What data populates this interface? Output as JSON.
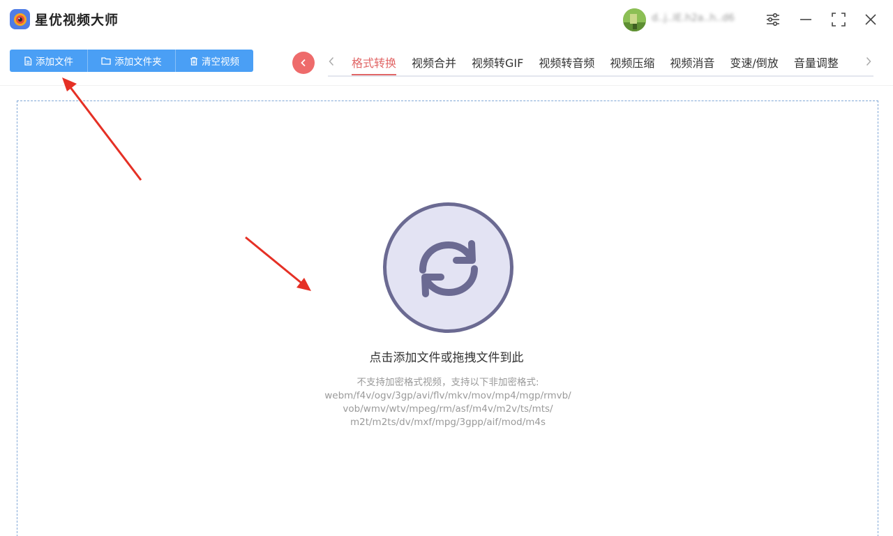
{
  "app": {
    "title": "星优视频大师",
    "username": "d..j..IE.h2a..h..d6"
  },
  "toolbar": {
    "add_file": "添加文件",
    "add_folder": "添加文件夹",
    "clear_videos": "清空视频"
  },
  "tabs": [
    {
      "label": "格式转换",
      "active": true
    },
    {
      "label": "视频合并"
    },
    {
      "label": "视频转GIF"
    },
    {
      "label": "视频转音频"
    },
    {
      "label": "视频压缩"
    },
    {
      "label": "视频消音"
    },
    {
      "label": "变速/倒放"
    },
    {
      "label": "音量调整"
    }
  ],
  "drop": {
    "hint": "点击添加文件或拖拽文件到此",
    "formats_lines": [
      "不支持加密格式视频，支持以下非加密格式:",
      "webm/f4v/ogv/3gp/avi/flv/mkv/mov/mp4/mgp/rmvb/",
      "vob/wmv/wtv/mpeg/rm/asf/m4v/m2v/ts/mts/",
      "m2t/m2ts/dv/mxf/mpg/3gpp/aif/mod/m4s"
    ]
  },
  "colors": {
    "accent_blue": "#4a9ff5",
    "accent_red": "#e16666",
    "annotation_arrow": "#e53025"
  },
  "icons": {
    "app_logo": "camera-lens-icon",
    "settings": "sliders-icon",
    "minimize": "minimize-icon",
    "maximize": "maximize-icon",
    "close": "close-icon",
    "convert": "refresh-arrows-icon"
  }
}
